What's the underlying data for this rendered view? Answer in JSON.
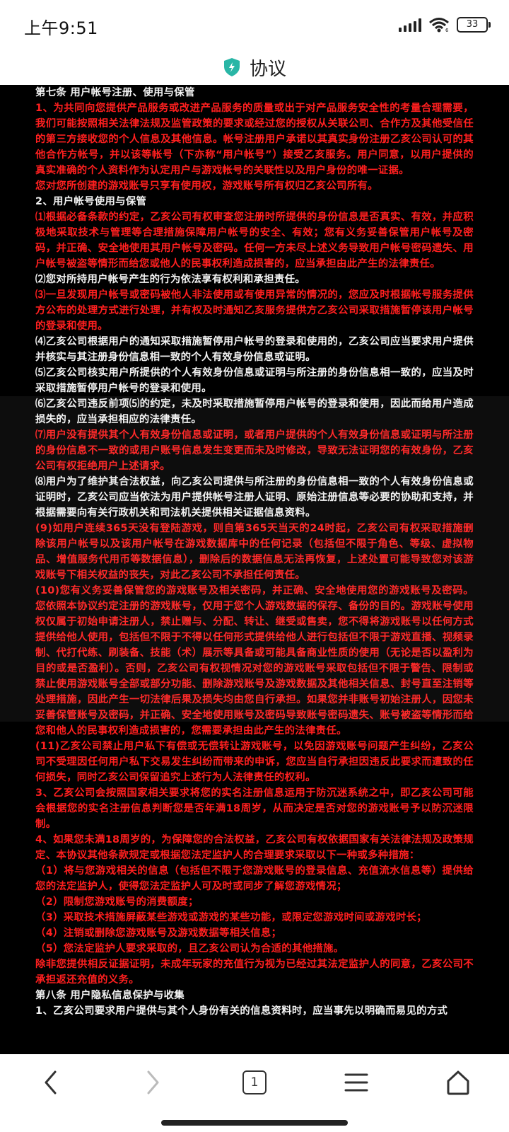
{
  "status_bar": {
    "time": "上午9:51",
    "battery": "33"
  },
  "header": {
    "title": "协议"
  },
  "content": {
    "paragraphs": [
      {
        "style": "white",
        "text": "第七条 用户帐号注册、使用与保管"
      },
      {
        "style": "red",
        "text": "1、为共同向您提供产品服务或改进产品服务的质量或出于对产品服务安全性的考量合理需要，我们可能按照相关法律法规及监管政策的要求或经过您的授权从关联公司、合作方及其他受信任的第三方接收您的个人信息及其他信息。帐号注册用户承诺以其真实身份注册乙亥公司认可的其他合作方帐号，并以该等帐号（下亦称“用户帐号”）接受乙亥服务。用户同意，以用户提供的真实准确的个人资料作为认定用户与游戏帐号的关联性以及用户身份的唯一证据。"
      },
      {
        "style": "red",
        "text": "您对您所创建的游戏账号只享有使用权，游戏账号所有权归乙亥公司所有。"
      },
      {
        "style": "white",
        "text": "2、用户帐号使用与保管"
      },
      {
        "style": "red",
        "text": "⑴根据必备条款的约定，乙亥公司有权审查您注册时所提供的身份信息是否真实、有效，并应积极地采取技术与管理等合理措施保障用户帐号的安全、有效；您有义务妥善保管用户帐号及密码，并正确、安全地使用其用户帐号及密码。任何一方未尽上述义务导致用户帐号密码遗失、用户帐号被盗等情形而给您或他人的民事权利造成损害的，应当承担由此产生的法律责任。"
      },
      {
        "style": "white",
        "text": "⑵您对所持用户帐号产生的行为依法享有权利和承担责任。"
      },
      {
        "style": "red",
        "text": "⑶一旦发现用户帐号或密码被他人非法使用或有使用异常的情况的，您应及时根据帐号服务提供方公布的处理方式进行处理，并有权及时通知乙亥服务提供方乙亥公司采取措施暂停该用户帐号的登录和使用。"
      },
      {
        "style": "white",
        "text": "⑷乙亥公司根据用户的通知采取措施暂停用户帐号的登录和使用的，乙亥公司应当要求用户提供并核实与其注册身份信息相一致的个人有效身份信息或证明。"
      },
      {
        "style": "white",
        "text": "⑸乙亥公司核实用户所提供的个人有效身份信息或证明与所注册的身份信息相一致的，应当及时采取措施暂停用户帐号的登录和使用。"
      },
      {
        "style": "white",
        "text": "⑹乙亥公司违反前项⑸的约定，未及时采取措施暂停用户帐号的登录和使用，因此而给用户造成损失的，应当承担相应的法律责任。"
      },
      {
        "style": "red",
        "text": "⑺用户没有提供其个人有效身份信息或证明，或者用户提供的个人有效身份信息或证明与所注册的身份信息不一致的或用户账号信息发生变更而未及时修改，导致无法证明您的有效身份，乙亥公司有权拒绝用户上述请求。"
      },
      {
        "style": "white",
        "text": "⑻用户为了维护其合法权益，向乙亥公司提供与所注册的身份信息相一致的个人有效身份信息或证明时，乙亥公司应当依法为用户提供帐号注册人证明、原始注册信息等必要的协助和支持，并根据需要向有关行政机关和司法机关提供相关证据信息资料。"
      },
      {
        "style": "red",
        "text": "(9)如用户连续365天没有登陆游戏，则自第365天当天的24时起，乙亥公司有权采取措施删除该用户帐号以及该用户帐号在游戏数据库中的任何记录（包括但不限于角色、等级、虚拟物品、增值服务代用币等数据信息），删除后的数据信息无法再恢复，上述处置可能导致您对该游戏账号下相关权益的丧失，对此乙亥公司不承担任何责任。"
      },
      {
        "style": "red",
        "text": "(10)您有义务妥善保管您的游戏账号及相关密码，并正确、安全地使用您的游戏账号及密码。您依照本协议约定注册的游戏账号，仅用于您个人游戏数据的保存、备份的目的。游戏账号使用权仅属于初始申请注册人，禁止赠与、分配、转让、继受或售卖，您不得将游戏账号以任何方式提供给他人使用，包括但不限于不得以任何形式提供给他人进行包括但不限于游戏直播、视频录制、代打代练、刷装备、技能（术）展示等具备或可能具备商业性质的使用（无论是否以盈利为目的或是否盈利）。否则，乙亥公司有权视情况对您的游戏账号采取包括但不限于警告、限制或禁止使用游戏账号全部或部分功能、删除游戏账号及游戏数据及其他相关信息、封号直至注销等处理措施，因此产生一切法律后果及损失均由您自行承担。如果您并非账号初始注册人，因您未妥善保管账号及密码，并正确、安全地使用账号及密码导致账号密码遗失、账号被盗等情形而给您和他人的民事权利造成损害的，您需要承担由此产生的法律责任。"
      },
      {
        "style": "red",
        "text": "(11)乙亥公司禁止用户私下有偿或无偿转让游戏账号，以免因游戏账号问题产生纠纷，乙亥公司不受理因任何用户私下交易发生纠纷而带来的申诉，您应当自行承担因违反此要求而遭致的任何损失，同时乙亥公司保留追究上述行为人法律责任的权利。"
      },
      {
        "style": "red",
        "text": "3、乙亥公司会按照国家相关要求将您的实名注册信息运用于防沉迷系统之中，即乙亥公司可能会根据您的实名注册信息判断您是否年满18周岁，从而决定是否对您的游戏账号予以防沉迷限制。"
      },
      {
        "style": "red",
        "text": "4、如果您未满18周岁的，为保障您的合法权益，乙亥公司有权依据国家有关法律法规及政策规定、本协议其他条款规定或根据您法定监护人的合理要求采取以下一种或多种措施："
      },
      {
        "style": "red",
        "text": "（1）将与您游戏相关的信息（包括但不限于您游戏账号的登录信息、充值流水信息等）提供给您的法定监护人，使得您法定监护人可及时或同步了解您游戏情况；"
      },
      {
        "style": "red",
        "text": "（2）限制您游戏账号的消费额度；"
      },
      {
        "style": "red",
        "text": "（3）采取技术措施屏蔽某些游戏或游戏的某些功能，或限定您游戏时间或游戏时长；"
      },
      {
        "style": "red",
        "text": "（4）注销或删除您游戏账号及游戏数据等相关信息；"
      },
      {
        "style": "red",
        "text": "（5）您法定监护人要求采取的，且乙亥公司认为合适的其他措施。"
      },
      {
        "style": "red",
        "text": "除非您提供相反证据证明，未成年玩家的充值行为视为已经过其法定监护人的同意，乙亥公司不承担返还充值的义务。"
      },
      {
        "style": "white",
        "text": "第八条 用户隐私信息保护与收集"
      },
      {
        "style": "white",
        "text": "1、乙亥公司要求用户提供与其个人身份有关的信息资料时，应当事先以明确而易见的方式"
      }
    ]
  },
  "nav": {
    "back_icon": "chevron-left-icon",
    "forward_icon": "chevron-right-icon",
    "tabs_count": "1",
    "menu_icon": "menu-icon",
    "home_icon": "home-icon"
  }
}
